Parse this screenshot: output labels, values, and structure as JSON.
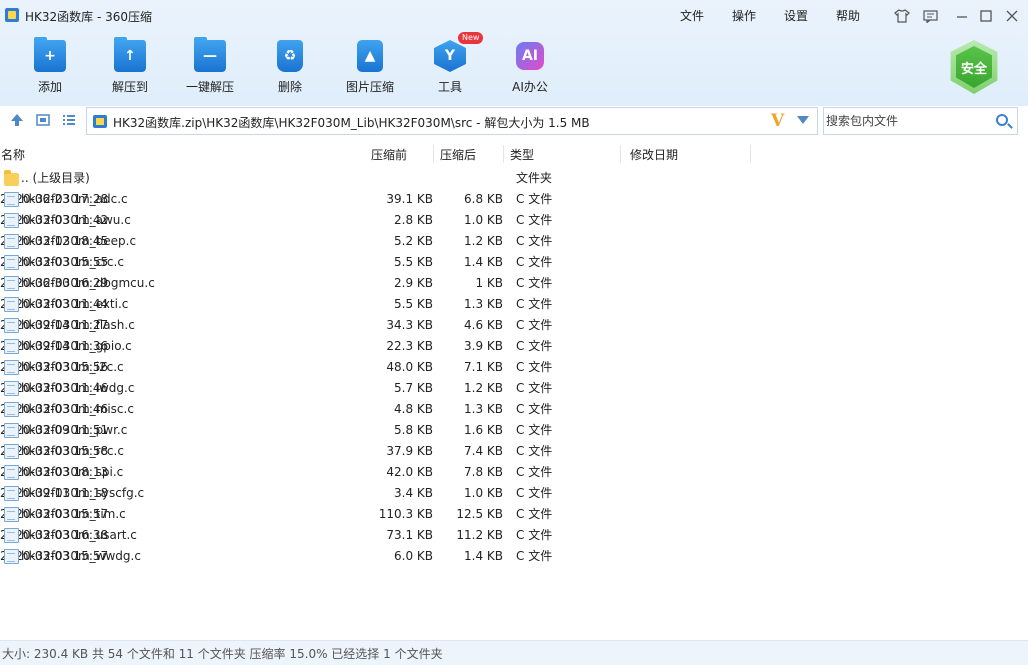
{
  "window": {
    "title": "HK32函数库 - 360压缩",
    "menu": [
      "文件",
      "操作",
      "设置",
      "帮助"
    ]
  },
  "toolbar": [
    {
      "label": "添加",
      "icon": "add-folder-icon"
    },
    {
      "label": "解压到",
      "icon": "extract-to-icon"
    },
    {
      "label": "一键解压",
      "icon": "one-click-extract-icon"
    },
    {
      "label": "删除",
      "icon": "recycle-bin-icon"
    },
    {
      "label": "图片压缩",
      "icon": "image-compress-icon"
    },
    {
      "label": "工具",
      "icon": "tools-icon",
      "badge": "New"
    },
    {
      "label": "AI办公",
      "icon": "ai-office-icon",
      "glyph": "AI"
    }
  ],
  "safety": {
    "label": "安全"
  },
  "address": {
    "path": "HK32函数库.zip\\HK32函数库\\HK32F030M_Lib\\HK32F030M\\src - 解包大小为 1.5 MB"
  },
  "search": {
    "placeholder": "搜索包内文件"
  },
  "columns": {
    "name": "名称",
    "size": "压缩前",
    "packed": "压缩后",
    "type": "类型",
    "modified": "修改日期"
  },
  "files": [
    {
      "name": ".. (上级目录)",
      "size": "",
      "packed": "",
      "type": "文件夹",
      "modified": "",
      "kind": "folder"
    },
    {
      "name": "hk32f030m_adc.c",
      "size": "39.1 KB",
      "packed": "6.8 KB",
      "type": "C 文件",
      "modified": "2020-06-23 17:28",
      "kind": "file"
    },
    {
      "name": "hk32f030m_awu.c",
      "size": "2.8 KB",
      "packed": "1.0 KB",
      "type": "C 文件",
      "modified": "2020-03-03 11:42",
      "kind": "file"
    },
    {
      "name": "hk32f030m_beep.c",
      "size": "5.2 KB",
      "packed": "1.2 KB",
      "type": "C 文件",
      "modified": "2020-03-12 18:45",
      "kind": "file"
    },
    {
      "name": "hk32f030m_crc.c",
      "size": "5.5 KB",
      "packed": "1.4 KB",
      "type": "C 文件",
      "modified": "2020-03-03 15:55",
      "kind": "file"
    },
    {
      "name": "hk32f030m_dbgmcu.c",
      "size": "2.9 KB",
      "packed": "1 KB",
      "type": "C 文件",
      "modified": "2020-06-30 16:29",
      "kind": "file"
    },
    {
      "name": "hk32f030m_exti.c",
      "size": "5.5 KB",
      "packed": "1.3 KB",
      "type": "C 文件",
      "modified": "2020-03-03 11:44",
      "kind": "file"
    },
    {
      "name": "hk32f030m_flash.c",
      "size": "34.3 KB",
      "packed": "4.6 KB",
      "type": "C 文件",
      "modified": "2020-09-14 11:27",
      "kind": "file"
    },
    {
      "name": "hk32f030m_gpio.c",
      "size": "22.3 KB",
      "packed": "3.9 KB",
      "type": "C 文件",
      "modified": "2020-09-14 11:36",
      "kind": "file"
    },
    {
      "name": "hk32f030m_i2c.c",
      "size": "48.0 KB",
      "packed": "7.1 KB",
      "type": "C 文件",
      "modified": "2020-03-03 15:56",
      "kind": "file"
    },
    {
      "name": "hk32f030m_iwdg.c",
      "size": "5.7 KB",
      "packed": "1.2 KB",
      "type": "C 文件",
      "modified": "2020-03-03 11:46",
      "kind": "file"
    },
    {
      "name": "hk32f030m_misc.c",
      "size": "4.8 KB",
      "packed": "1.3 KB",
      "type": "C 文件",
      "modified": "2020-03-03 11:46",
      "kind": "file"
    },
    {
      "name": "hk32f030m_pwr.c",
      "size": "5.8 KB",
      "packed": "1.6 KB",
      "type": "C 文件",
      "modified": "2020-03-09 11:51",
      "kind": "file"
    },
    {
      "name": "hk32f030m_rcc.c",
      "size": "37.9 KB",
      "packed": "7.4 KB",
      "type": "C 文件",
      "modified": "2020-03-03 15:58",
      "kind": "file"
    },
    {
      "name": "hk32f030m_spi.c",
      "size": "42.0 KB",
      "packed": "7.8 KB",
      "type": "C 文件",
      "modified": "2020-03-03 18:13",
      "kind": "file"
    },
    {
      "name": "hk32f030m_syscfg.c",
      "size": "3.4 KB",
      "packed": "1.0 KB",
      "type": "C 文件",
      "modified": "2020-09-11 11:18",
      "kind": "file"
    },
    {
      "name": "hk32f030m_tim.c",
      "size": "110.3 KB",
      "packed": "12.5 KB",
      "type": "C 文件",
      "modified": "2020-03-03 15:57",
      "kind": "file"
    },
    {
      "name": "hk32f030m_usart.c",
      "size": "73.1 KB",
      "packed": "11.2 KB",
      "type": "C 文件",
      "modified": "2020-03-03 16:38",
      "kind": "file"
    },
    {
      "name": "hk32f030m_wwdg.c",
      "size": "6.0 KB",
      "packed": "1.4 KB",
      "type": "C 文件",
      "modified": "2020-03-03 15:57",
      "kind": "file"
    }
  ],
  "status": {
    "text": "大小: 230.4 KB 共 54 个文件和 11 个文件夹 压缩率 15.0% 已经选择 1 个文件夹"
  },
  "colors": {
    "accent": "#1a73d1",
    "header_bg": "#e3effb",
    "safe_green": "#3aa52e"
  }
}
